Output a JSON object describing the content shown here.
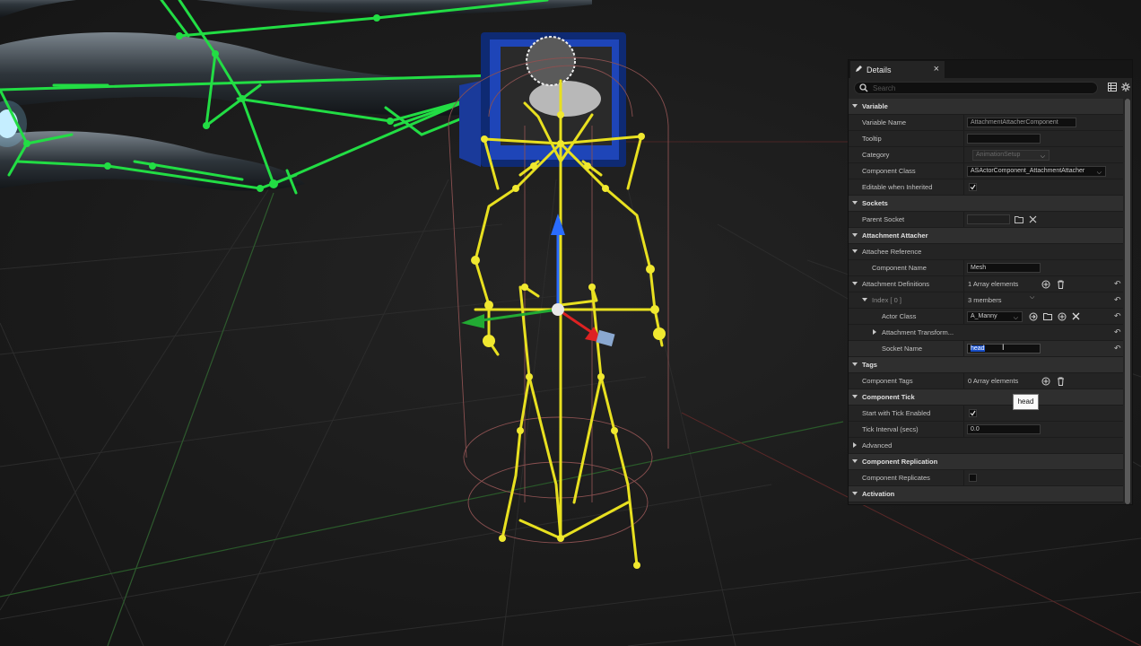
{
  "panel": {
    "tab_title": "Details",
    "close_glyph": "×",
    "search_placeholder": "Search",
    "icons": [
      "pencil-icon",
      "search-icon",
      "view-options-icon",
      "settings-icon"
    ]
  },
  "sections": {
    "variable": {
      "title": "Variable",
      "variable_name_label": "Variable Name",
      "variable_name_value": "AttachmentAttacherComponent",
      "tooltip_label": "Tooltip",
      "tooltip_value": "",
      "category_label": "Category",
      "category_value": "AnimationSetup",
      "component_class_label": "Component Class",
      "component_class_value": "ASActorComponent_AttachmentAttacher",
      "editable_label": "Editable when Inherited",
      "editable_checked": true
    },
    "sockets": {
      "title": "Sockets",
      "parent_socket_label": "Parent Socket",
      "parent_socket_value": ""
    },
    "attacher": {
      "title": "Attachment Attacher",
      "attachee_label": "Attachee Reference",
      "component_name_label": "Component Name",
      "component_name_value": "Mesh",
      "definitions_label": "Attachment Definitions",
      "definitions_value": "1 Array elements",
      "index_label": "Index [ 0 ]",
      "index_value": "3 members",
      "actor_class_label": "Actor Class",
      "actor_class_value": "A_Manny",
      "transform_label": "Attachment Transform...",
      "socket_name_label": "Socket Name",
      "socket_name_value": "head",
      "tooltip_text": "head"
    },
    "tags": {
      "title": "Tags",
      "component_tags_label": "Component Tags",
      "component_tags_value": "0 Array elements"
    },
    "tick": {
      "title": "Component Tick",
      "start_label": "Start with Tick Enabled",
      "start_checked": true,
      "interval_label": "Tick Interval (secs)",
      "interval_value": "0.0",
      "advanced_label": "Advanced"
    },
    "replication": {
      "title": "Component Replication",
      "replicates_label": "Component Replicates",
      "replicates_checked": false
    },
    "activation": {
      "title": "Activation"
    }
  },
  "colors": {
    "green_skeleton": "#22dd44",
    "yellow_skeleton": "#e8e020",
    "capsule": "#8a5050",
    "panel_bg": "#242424",
    "selection": "#1a50c8"
  }
}
